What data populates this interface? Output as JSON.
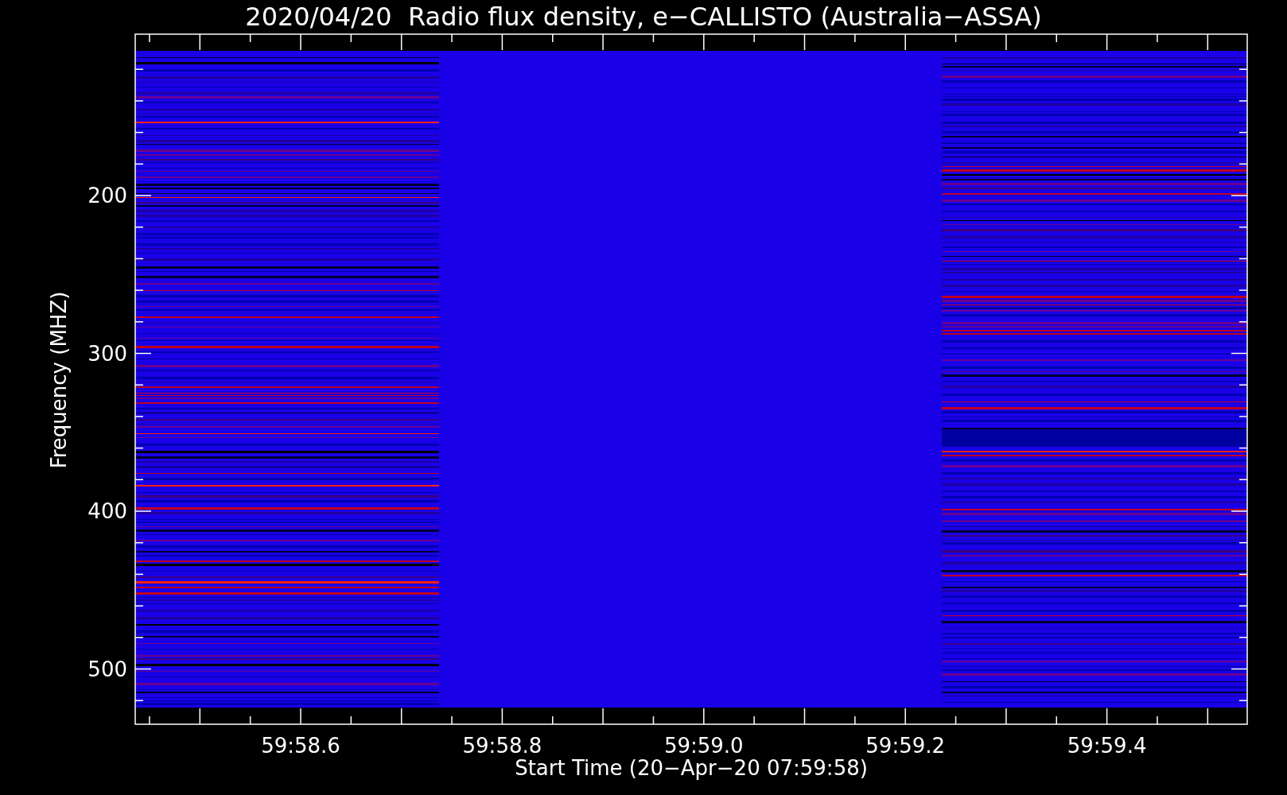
{
  "title": "2020/04/20  Radio flux density, e−CALLISTO (Australia−ASSA)",
  "y_axis": {
    "label": "Frequency (MHZ)",
    "ticks": [
      "200",
      "300",
      "400",
      "500"
    ]
  },
  "x_axis": {
    "label": "Start Time (20−Apr−20 07:59:58)",
    "ticks": [
      "59:58.6",
      "59:58.8",
      "59:59.0",
      "59:59.2",
      "59:59.4"
    ]
  }
}
